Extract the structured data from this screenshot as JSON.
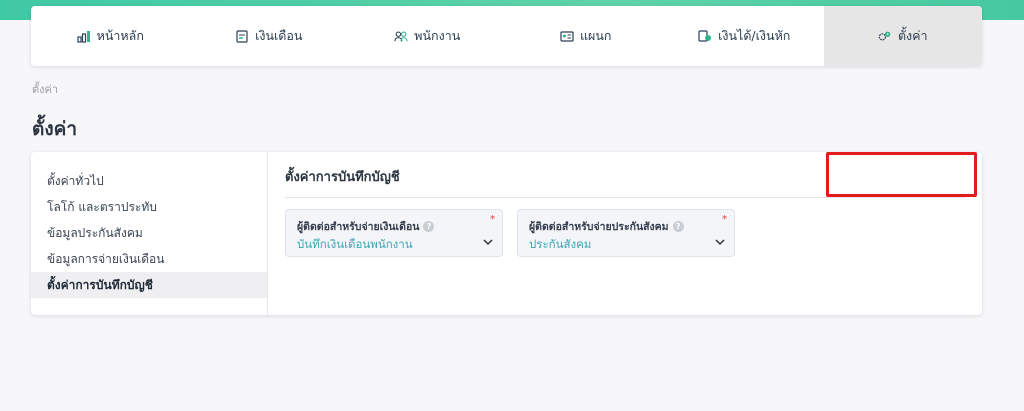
{
  "nav": {
    "items": [
      {
        "label": "หน้าหลัก",
        "icon": "bar-chart-icon"
      },
      {
        "label": "เงินเดือน",
        "icon": "calendar-doc-icon"
      },
      {
        "label": "พนักงาน",
        "icon": "users-icon"
      },
      {
        "label": "แผนก",
        "icon": "id-card-icon"
      },
      {
        "label": "เงินได้/เงินหัก",
        "icon": "money-icon"
      },
      {
        "label": "ตั้งค่า",
        "icon": "gears-icon"
      }
    ],
    "active_index": 5
  },
  "breadcrumb": "ตั้งค่า",
  "page_title": "ตั้งค่า",
  "sidebar": {
    "items": [
      {
        "label": "ตั้งค่าทั่วไป"
      },
      {
        "label": "โลโก้ และตราประทับ"
      },
      {
        "label": "ข้อมูลประกันสังคม"
      },
      {
        "label": "ข้อมูลการจ่ายเงินเดือน"
      },
      {
        "label": "ตั้งค่าการบันทึกบัญชี"
      }
    ],
    "active_index": 4
  },
  "section": {
    "title": "ตั้งค่าการบันทึกบัญชี"
  },
  "fields": [
    {
      "label": "ผู้ติดต่อสำหรับจ่ายเงินเดือน",
      "value": "บันทึกเงินเดือนพนักงาน",
      "required": "*"
    },
    {
      "label": "ผู้ติดต่อสำหรับจ่ายประกันสังคม",
      "value": "ประกันสังคม",
      "required": "*"
    }
  ],
  "colors": {
    "accent_gradient": "#3fc9a4",
    "value_text": "#3ba6b3",
    "highlight_border": "#e31b1b",
    "icon_green": "#2fb58a"
  }
}
